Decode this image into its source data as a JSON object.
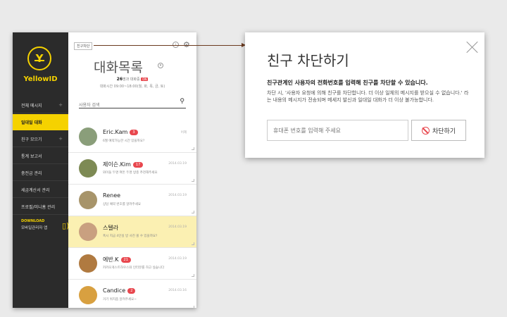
{
  "sidebar": {
    "logo_text": "YellowID",
    "items": [
      {
        "label": "전체 메시지",
        "active": false,
        "plus": true
      },
      {
        "label": "일대일 대화",
        "active": true,
        "plus": false
      },
      {
        "label": "친구 모으기",
        "active": false,
        "plus": true
      },
      {
        "label": "통계 보고서",
        "active": false,
        "plus": false
      },
      {
        "label": "충전금 관리",
        "active": false,
        "plus": false
      },
      {
        "label": "세금계산서 관리",
        "active": false,
        "plus": false
      },
      {
        "label": "프로필/미니홈 관리",
        "active": false,
        "plus": false
      }
    ],
    "download_title": "DOWNLOAD",
    "download_sub": "모바일관리자 앱"
  },
  "header": {
    "friend_block_label": "친구차단",
    "title": "대화목록",
    "count": "26",
    "count_suffix": "명과 대화중",
    "on_label": "ON",
    "hours": "대화시간 09:00~18:00(월, 화, 목, 금, 토)"
  },
  "search": {
    "placeholder": "사용자 검색"
  },
  "conversations": [
    {
      "name": "Eric.Kam",
      "badge": "3",
      "preview": "6월 예약가능한 시간 있을까요?",
      "date": "어제",
      "highlight": false,
      "avatar": "#8a9e7a"
    },
    {
      "name": "제이슨.Kim",
      "badge": "17",
      "preview": "와이들 두명 여돈 두명 방충 추천해주세요",
      "date": "2014.03.19",
      "highlight": false,
      "avatar": "#7d8a54"
    },
    {
      "name": "Renee",
      "badge": "",
      "preview": "상담 예약 번호를 알려주세요",
      "date": "2014.03.19",
      "highlight": false,
      "avatar": "#a7946a"
    },
    {
      "name": "스텔라",
      "badge": "",
      "preview": "혹시 지금 4인실 방 사진 볼 수 있을까요?",
      "date": "2014.03.19",
      "highlight": true,
      "avatar": "#c9a080"
    },
    {
      "name": "에반.K",
      "badge": "21",
      "preview": "카카오게스트하우스와 인터뷰를 하고 싶습니다",
      "date": "2014.03.19",
      "highlight": false,
      "avatar": "#b07a40"
    },
    {
      "name": "Candice",
      "badge": "2",
      "preview": "거기 위치좀 알려주세요~",
      "date": "2014.03.16",
      "highlight": false,
      "avatar": "#d8a040"
    }
  ],
  "dialog": {
    "title": "친구 차단하기",
    "lead": "친구관계인 사용자의 전화번호를 입력해 친구를 차단할 수 있습니다.",
    "desc": "차단 시, '사용자 요청에 의해 친구를 차단합니다. 더 이상 일체의 메시지를 받으실 수 없습니다.' 라는 내용의 메시지가 전송되며 메세지 발신과 일대일 대화가 더 이상 불가능합니다.",
    "input_placeholder": "휴대폰 번호를 입력해 주세요",
    "button_label": "차단하기"
  },
  "colors": {
    "brand": "#f5d200",
    "sidebar_bg": "#2b2b2b",
    "alert": "#e8474e",
    "highlight_row": "#fbf0b2"
  }
}
